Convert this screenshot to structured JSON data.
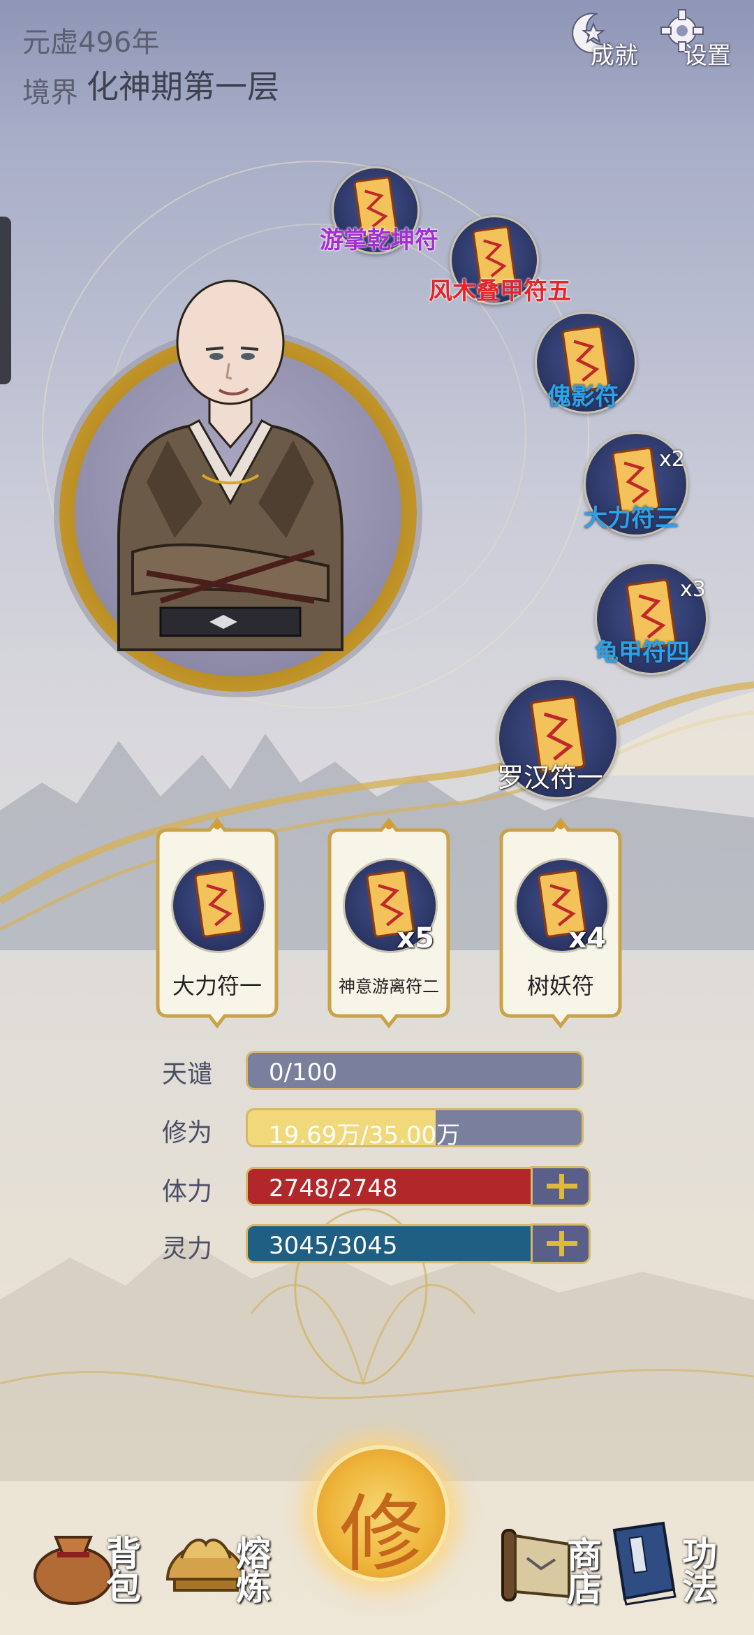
{
  "header": {
    "year": "元虚496年",
    "realm_label": "境界",
    "realm_value": "化神期第一层",
    "achievements_label": "成就",
    "settings_label": "设置"
  },
  "talismans": [
    {
      "name": "游掌乾坤符",
      "color": "#a32fd0",
      "count": ""
    },
    {
      "name": "风木叠甲符五",
      "color": "#e2262b",
      "count": ""
    },
    {
      "name": "傀影符",
      "color": "#2aa3ef",
      "count": ""
    },
    {
      "name": "大力符三",
      "color": "#2aa3ef",
      "count": "x2"
    },
    {
      "name": "龟甲符四",
      "color": "#2aa3ef",
      "count": "x3"
    },
    {
      "name": "罗汉符一",
      "color": "#ffffff",
      "count": ""
    }
  ],
  "cards": [
    {
      "name": "大力符一",
      "count": ""
    },
    {
      "name": "神意游离符二",
      "count": "x5"
    },
    {
      "name": "树妖符",
      "count": "x4"
    }
  ],
  "stats": {
    "tianqian": {
      "label": "天谴",
      "text": "0/100",
      "value": 0,
      "max": 100,
      "color": "#7a7f9e"
    },
    "xiuwei": {
      "label": "修为",
      "text": "19.69万/35.00万",
      "value": 19.69,
      "max": 35.0,
      "color": "#f1d87a"
    },
    "tili": {
      "label": "体力",
      "text": "2748/2748",
      "value": 2748,
      "max": 2748,
      "color": "#b22729"
    },
    "lingli": {
      "label": "灵力",
      "text": "3045/3045",
      "value": 3045,
      "max": 3045,
      "color": "#1f5f83"
    }
  },
  "nav": {
    "bag": "背包",
    "smelt": "熔炼",
    "cultivate": "修",
    "shop": "商店",
    "technique": "功法"
  },
  "icons": {
    "achievements": "crescent-star-icon",
    "settings": "gear-icon",
    "bag": "money-bag-icon",
    "smelt": "lotus-bowl-icon",
    "shop": "map-scroll-icon",
    "technique": "book-icon"
  }
}
